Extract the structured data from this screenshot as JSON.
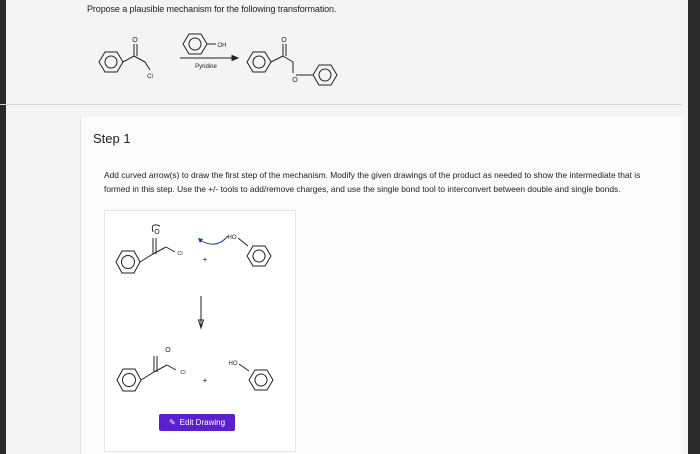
{
  "question": {
    "prompt": "Propose a plausible mechanism for the following transformation."
  },
  "scheme": {
    "reactant_labels": {
      "oxygen": "O",
      "chlorine": "Cl"
    },
    "reagent_labels": {
      "hydroxyl": "OH",
      "conditions": "Pyridine"
    },
    "product_labels": {
      "carbonyl_oxygen": "O",
      "ester_oxygen": "O"
    }
  },
  "step": {
    "title": "Step 1",
    "instructions": "Add curved arrow(s) to draw the first step of the mechanism. Modify the given drawings of the product as needed to show the intermediate that is formed in this step. Use the +/- tools to add/remove charges, and use the single bond tool to interconvert between double and single bonds."
  },
  "drawing": {
    "top_labels": {
      "carbonyl_oxygen": "O",
      "chlorine": "Cl",
      "plus": "+",
      "hydroxyl": "HO"
    },
    "bottom_labels": {
      "carbonyl_oxygen": "O",
      "chlorine": "Cl",
      "plus": "+",
      "hydroxyl": "HO"
    },
    "edit_button": {
      "label": "Edit Drawing",
      "icon": "pencil-icon"
    }
  },
  "colors": {
    "button": "#5a1fd1",
    "page": "#f4f4f4",
    "frame": "#2a2a2a"
  }
}
